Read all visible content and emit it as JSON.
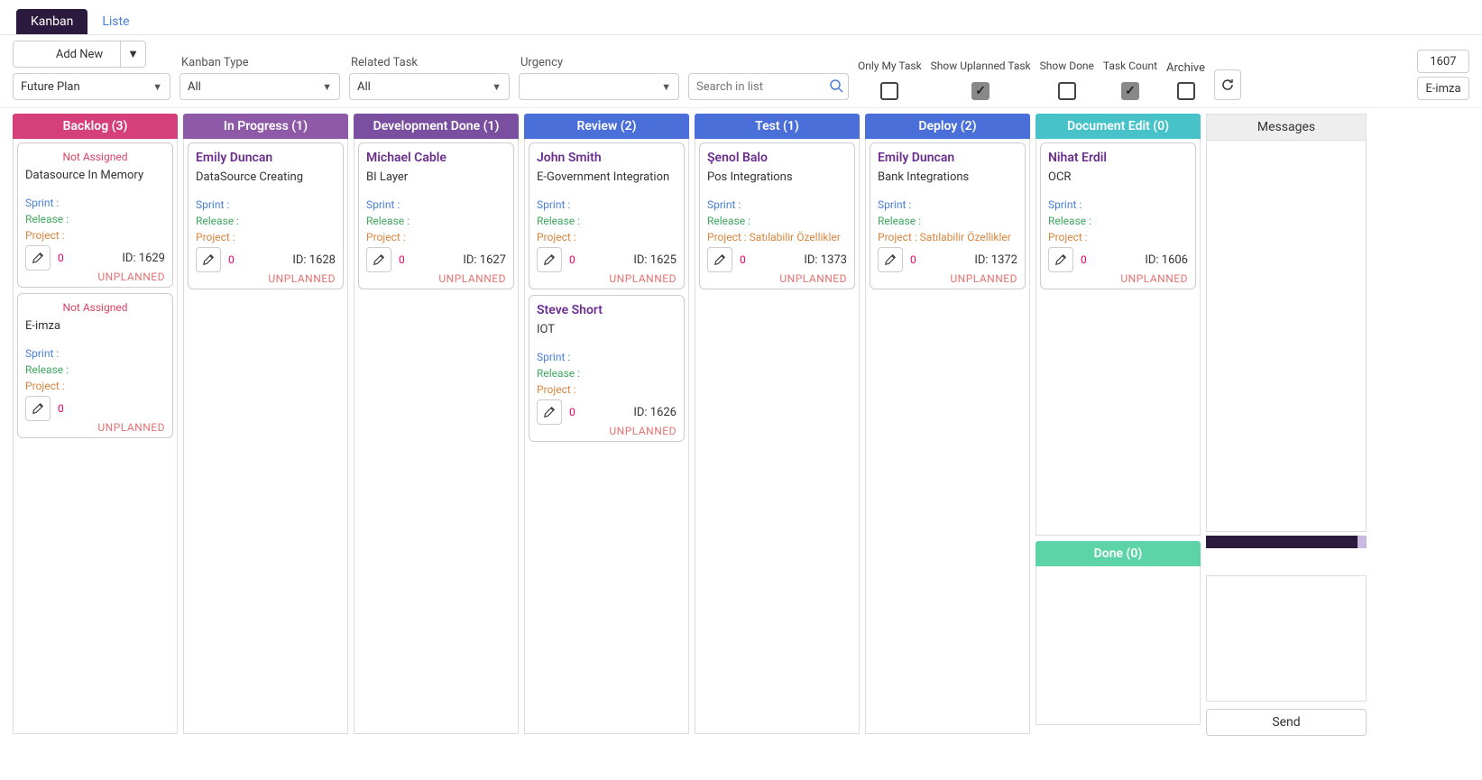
{
  "tabs": {
    "kanban": "Kanban",
    "liste": "Liste"
  },
  "toolbar": {
    "add_new": "Add New",
    "kanban_type_label": "Kanban Type",
    "kanban_type_value": "All",
    "related_task_label": "Related Task",
    "related_task_value": "All",
    "urgency_label": "Urgency",
    "urgency_value": "",
    "future_plan": "Future Plan",
    "search_placeholder": "Search in list",
    "only_my_task": "Only My Task",
    "show_uplanned": "Show Uplanned Task",
    "show_done": "Show Done",
    "task_count": "Task Count",
    "archive": "Archive",
    "top_number": "1607",
    "top_text": "E-imza"
  },
  "labels": {
    "sprint": "Sprint :",
    "release": "Release :",
    "project": "Project :",
    "id_prefix": "ID: ",
    "unplanned": "UNPLANNED",
    "not_assigned": "Not Assigned",
    "messages": "Messages",
    "send": "Send"
  },
  "columns": [
    {
      "header": "Backlog (3)",
      "color": "#d53f7a",
      "cards": [
        {
          "assignee": "Not Assigned",
          "na": true,
          "title": "Datasource In Memory",
          "project": "",
          "id": "1629",
          "count": "0"
        },
        {
          "assignee": "Not Assigned",
          "na": true,
          "title": "E-imza",
          "project": "",
          "id": "",
          "count": "0",
          "noid": true
        }
      ]
    },
    {
      "header": "In Progress (1)",
      "color": "#8e5aa8",
      "cards": [
        {
          "assignee": "Emily Duncan",
          "title": "DataSource Creating",
          "project": "",
          "id": "1628",
          "count": "0"
        }
      ]
    },
    {
      "header": "Development Done (1)",
      "color": "#7a4fa0",
      "cards": [
        {
          "assignee": "Michael Cable",
          "title": "BI Layer",
          "project": "",
          "id": "1627",
          "count": "0"
        }
      ]
    },
    {
      "header": "Review (2)",
      "color": "#4a6fd8",
      "cards": [
        {
          "assignee": "John Smith",
          "title": "E-Government Integration",
          "project": "",
          "id": "1625",
          "count": "0"
        },
        {
          "assignee": "Steve Short",
          "title": "IOT",
          "project": "",
          "id": "1626",
          "count": "0"
        }
      ]
    },
    {
      "header": "Test (1)",
      "color": "#4a6fd8",
      "cards": [
        {
          "assignee": "Şenol Balo",
          "title": "Pos Integrations",
          "project": "Satılabilir Özellikler",
          "id": "1373",
          "count": "0"
        }
      ]
    },
    {
      "header": "Deploy (2)",
      "color": "#4a6fd8",
      "cards": [
        {
          "assignee": "Emily Duncan",
          "title": "Bank Integrations",
          "project": "Satılabilir Özellikler",
          "id": "1372",
          "count": "0"
        }
      ]
    }
  ],
  "col7": {
    "doc_header": "Document Edit (0)",
    "doc_color": "#48c2c9",
    "done_header": "Done (0)",
    "done_color": "#5dd3a8",
    "cards": [
      {
        "assignee": "Nihat Erdil",
        "title": "OCR",
        "project": "",
        "id": "1606",
        "count": "0"
      }
    ]
  }
}
